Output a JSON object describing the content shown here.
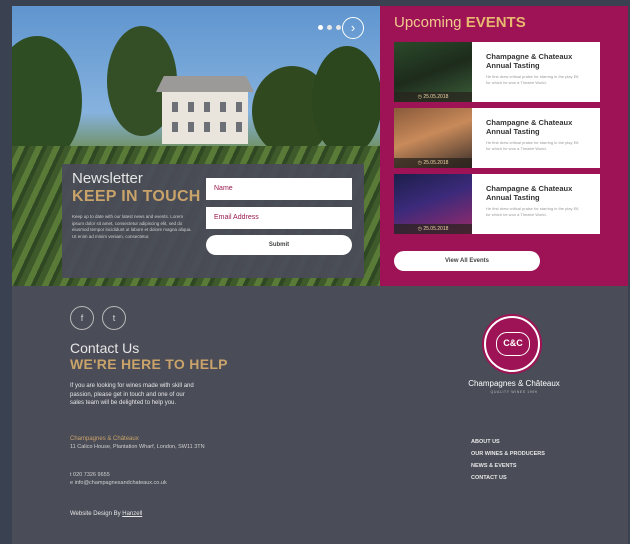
{
  "hero": {
    "slider_next": "›"
  },
  "newsletter": {
    "title_light": "Newsletter",
    "title_bold": "KEEP IN TOUCH",
    "body": "Keep up to date with our latest news and events. Lorem ipsum dolor sit amet, consectetur adipiscing elit, sed do eiusmod tempor incididunt ut labore et dolore magna aliqua. Ut enim ad minim veniam, consectetur.",
    "name_placeholder": "Name",
    "email_placeholder": "Email Address",
    "submit_label": "Submit"
  },
  "events": {
    "heading_light": "Upcoming",
    "heading_bold": "EVENTS",
    "items": [
      {
        "title": "Champagne & Chateaux Annual Tasting",
        "desc": "He first drew critical praise for starring in the play Elf, for which he won a Theatre World.",
        "date": "25.05.2018"
      },
      {
        "title": "Champagne & Chateaux Annual Tasting",
        "desc": "He first drew critical praise for starring in the play Elf, for which he won a Theatre World.",
        "date": "25.05.2018"
      },
      {
        "title": "Champagne & Chateaux Annual Tasting",
        "desc": "He first drew critical praise for starring in the play Elf, for which he won a Theatre World.",
        "date": "25.05.2018"
      }
    ],
    "view_all_label": "View All Events"
  },
  "footer": {
    "social": {
      "facebook": "f",
      "twitter": "t"
    },
    "contact_light": "Contact Us",
    "contact_bold": "WE'RE HERE TO HELP",
    "contact_body": "If you are looking for wines made with skill and passion, please get in touch and one of our sales team will be delighted to help you.",
    "company_name": "Champagnes & Châteaux",
    "address": "11 Calico House, Plantation Wharf, London, SW11 3TN",
    "phone": "t  020 7326 9655",
    "email": "e  info@champagnesandchateaux.co.uk",
    "credit_prefix": "Website Design By",
    "credit_link": "Hanzell",
    "logo_monogram": "C&C",
    "brand_name": "Champagnes & Châteaux",
    "brand_tagline": "QUALITY WINES 1999",
    "nav": [
      "ABOUT US",
      "OUR WINES & PRODUCERS",
      "NEWS & EVENTS",
      "CONTACT US"
    ]
  },
  "colors": {
    "accent_burgundy": "#9e1355",
    "accent_gold": "#c9a36a",
    "panel_grey": "#4a4c57"
  }
}
